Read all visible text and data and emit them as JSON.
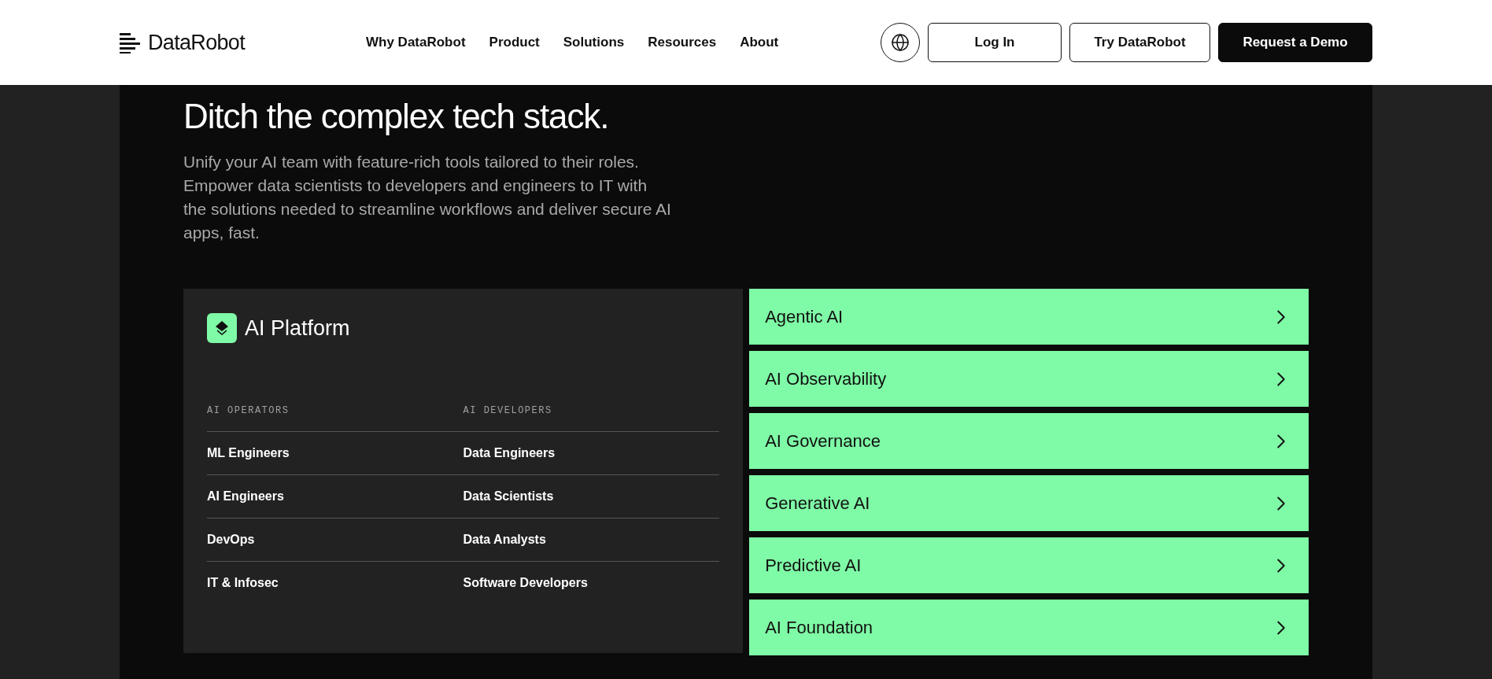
{
  "header": {
    "logo": "DataRobot",
    "nav": [
      "Why DataRobot",
      "Product",
      "Solutions",
      "Resources",
      "About"
    ],
    "buttons": [
      {
        "label": "Log In",
        "kind": "outline"
      },
      {
        "label": "Try DataRobot",
        "kind": "outline"
      },
      {
        "label": "Request a Demo",
        "kind": "solid"
      }
    ]
  },
  "hero": {
    "title": "Ditch the complex tech stack.",
    "text": "Unify your AI team with feature-rich tools tailored to their roles. Empower data scientists to developers and engineers to IT with the solutions needed to streamline workflows and deliver secure AI apps, fast."
  },
  "platform": {
    "title": "AI Platform",
    "columns": [
      {
        "heading": "AI OPERATORS",
        "items": [
          "ML Engineers",
          "AI Engineers",
          "DevOps",
          "IT & Infosec"
        ]
      },
      {
        "heading": "AI DEVELOPERS",
        "items": [
          "Data Engineers",
          "Data Scientists",
          "Data Analysts",
          "Software Developers"
        ]
      }
    ]
  },
  "solutions": [
    "Agentic AI",
    "AI Observability",
    "AI Governance",
    "Generative AI",
    "Predictive AI",
    "AI Foundation"
  ]
}
